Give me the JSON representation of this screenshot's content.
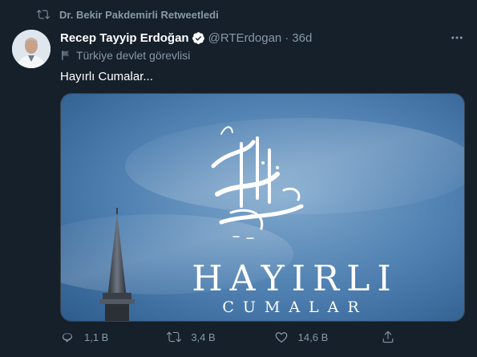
{
  "retweet": {
    "label": "Dr. Bekir Pakdemirli Retweetledi",
    "icon": "retweet-icon"
  },
  "tweet": {
    "author_name": "Recep Tayyip Erdoğan",
    "verified": true,
    "handle": "@RTErdogan",
    "separator": "·",
    "time": "36d",
    "account_label": "Türkiye devlet görevlisi",
    "text": "Hayırlı Cumalar..."
  },
  "media": {
    "headline": "HAYIRLI",
    "subheadline": "CUMALAR",
    "background_color": "#3f6f9f"
  },
  "actions": {
    "reply_count": "1,1 B",
    "retweet_count": "3,4 B",
    "like_count": "14,6 B"
  },
  "colors": {
    "background": "#15202b",
    "muted_text": "#8899a6",
    "primary_text": "#ffffff",
    "border": "#38444d"
  }
}
